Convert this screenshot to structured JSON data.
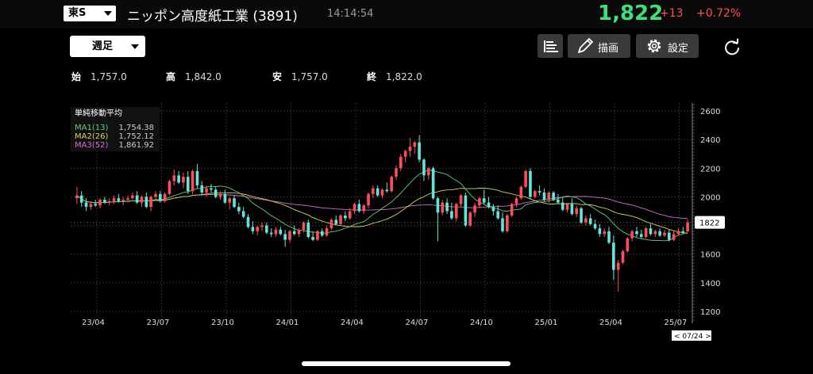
{
  "header": {
    "market": "東S",
    "title": "ニッポン高度紙工業 (3891)",
    "time": "14:14:54",
    "price": "1,822",
    "change": "+13",
    "change_percent": "+0.72%"
  },
  "toolbar": {
    "period": "週足",
    "draw_label": "描画",
    "settings_label": "設定"
  },
  "ohlc": [
    {
      "label": "始",
      "value": "1,757.0"
    },
    {
      "label": "高",
      "value": "1,842.0"
    },
    {
      "label": "安",
      "value": "1,757.0"
    },
    {
      "label": "終",
      "value": "1,822.0"
    }
  ],
  "ma_legend": {
    "title": "単純移動平均",
    "items": [
      {
        "name": "MA1(13)",
        "value": "1,754.38",
        "color": "#5fd07a"
      },
      {
        "name": "MA2(26)",
        "value": "1,752.12",
        "color": "#d4d45a"
      },
      {
        "name": "MA3(52)",
        "value": "1,861.92",
        "color": "#d66bd0"
      }
    ]
  },
  "colors": {
    "up": "#ff4d5a",
    "down": "#63e6d9",
    "price_green": "#3ee07a"
  },
  "chart_data": {
    "type": "candlestick",
    "ylim": [
      1200,
      2600
    ],
    "y_ticks": [
      "2600",
      "2400",
      "2200",
      "2000",
      "1800",
      "1600",
      "1400",
      "1200"
    ],
    "x_ticks": [
      "23/04",
      "23/07",
      "23/10",
      "24/01",
      "24/04",
      "24/07",
      "24/10",
      "25/01",
      "25/04",
      "25/07"
    ],
    "last_price_label": "1822",
    "cursor_label": "< 07/24 >",
    "candles": [
      [
        1990,
        2070,
        1950,
        2010
      ],
      [
        2010,
        2040,
        1930,
        1960
      ],
      [
        1960,
        1990,
        1900,
        1930
      ],
      [
        1930,
        1970,
        1910,
        1950
      ],
      [
        1950,
        1980,
        1930,
        1940
      ],
      [
        1940,
        1990,
        1920,
        1980
      ],
      [
        1980,
        2000,
        1950,
        1960
      ],
      [
        1960,
        1990,
        1940,
        1970
      ],
      [
        1970,
        2010,
        1950,
        1990
      ],
      [
        1990,
        2020,
        1960,
        1970
      ],
      [
        1970,
        2000,
        1940,
        1980
      ],
      [
        1980,
        2010,
        1960,
        1990
      ],
      [
        1990,
        2030,
        1980,
        2010
      ],
      [
        2010,
        2040,
        1950,
        1960
      ],
      [
        1960,
        2010,
        1930,
        2000
      ],
      [
        2000,
        2030,
        1920,
        1930
      ],
      [
        1930,
        2010,
        1900,
        2000
      ],
      [
        2000,
        2040,
        1980,
        2020
      ],
      [
        2020,
        2040,
        1960,
        1970
      ],
      [
        1970,
        2030,
        1960,
        2020
      ],
      [
        2020,
        2120,
        2010,
        2110
      ],
      [
        2110,
        2190,
        2080,
        2150
      ],
      [
        2150,
        2180,
        2090,
        2100
      ],
      [
        2100,
        2170,
        2060,
        2140
      ],
      [
        2140,
        2180,
        2020,
        2040
      ],
      [
        2040,
        2190,
        2020,
        2180
      ],
      [
        2180,
        2230,
        2060,
        2080
      ],
      [
        2080,
        2110,
        2010,
        2030
      ],
      [
        2030,
        2080,
        2000,
        2060
      ],
      [
        2060,
        2090,
        2030,
        2050
      ],
      [
        2050,
        2070,
        1990,
        2000
      ],
      [
        2000,
        2040,
        1980,
        2020
      ],
      [
        2020,
        2050,
        1950,
        1960
      ],
      [
        1960,
        2000,
        1910,
        1990
      ],
      [
        1990,
        2010,
        1920,
        1930
      ],
      [
        1930,
        1960,
        1880,
        1900
      ],
      [
        1900,
        1930,
        1850,
        1860
      ],
      [
        1860,
        1880,
        1780,
        1790
      ],
      [
        1790,
        1830,
        1740,
        1760
      ],
      [
        1760,
        1800,
        1730,
        1790
      ],
      [
        1790,
        1820,
        1760,
        1800
      ],
      [
        1800,
        1820,
        1740,
        1750
      ],
      [
        1750,
        1780,
        1720,
        1740
      ],
      [
        1740,
        1790,
        1720,
        1770
      ],
      [
        1770,
        1790,
        1730,
        1740
      ],
      [
        1740,
        1770,
        1650,
        1700
      ],
      [
        1700,
        1770,
        1680,
        1760
      ],
      [
        1760,
        1800,
        1730,
        1740
      ],
      [
        1740,
        1780,
        1720,
        1770
      ],
      [
        1770,
        1830,
        1750,
        1820
      ],
      [
        1820,
        1840,
        1710,
        1720
      ],
      [
        1720,
        1760,
        1690,
        1700
      ],
      [
        1700,
        1770,
        1690,
        1760
      ],
      [
        1760,
        1780,
        1720,
        1730
      ],
      [
        1730,
        1800,
        1720,
        1780
      ],
      [
        1780,
        1850,
        1770,
        1840
      ],
      [
        1840,
        1870,
        1800,
        1810
      ],
      [
        1810,
        1880,
        1800,
        1870
      ],
      [
        1870,
        1900,
        1830,
        1850
      ],
      [
        1850,
        1920,
        1840,
        1900
      ],
      [
        1900,
        1960,
        1880,
        1950
      ],
      [
        1950,
        1980,
        1890,
        1900
      ],
      [
        1900,
        1950,
        1880,
        1940
      ],
      [
        1940,
        2030,
        1920,
        2020
      ],
      [
        2020,
        2080,
        1990,
        2060
      ],
      [
        2060,
        2080,
        2000,
        2010
      ],
      [
        2010,
        2060,
        1990,
        2050
      ],
      [
        2050,
        2100,
        2030,
        2040
      ],
      [
        2040,
        2150,
        2030,
        2140
      ],
      [
        2140,
        2220,
        2120,
        2200
      ],
      [
        2200,
        2300,
        2180,
        2280
      ],
      [
        2280,
        2330,
        2240,
        2320
      ],
      [
        2320,
        2410,
        2280,
        2350
      ],
      [
        2350,
        2390,
        2300,
        2380
      ],
      [
        2380,
        2430,
        2240,
        2260
      ],
      [
        2260,
        2270,
        2110,
        2150
      ],
      [
        2150,
        2210,
        2120,
        2200
      ],
      [
        2200,
        2210,
        1980,
        1990
      ],
      [
        1990,
        2000,
        1690,
        1890
      ],
      [
        1890,
        1980,
        1870,
        1960
      ],
      [
        1960,
        1990,
        1880,
        1900
      ],
      [
        1900,
        1960,
        1840,
        1850
      ],
      [
        1850,
        1960,
        1830,
        1950
      ],
      [
        1950,
        2020,
        1930,
        2010
      ],
      [
        2010,
        2030,
        1790,
        1800
      ],
      [
        1800,
        1900,
        1790,
        1890
      ],
      [
        1890,
        1960,
        1860,
        1940
      ],
      [
        1940,
        2000,
        1920,
        1990
      ],
      [
        1990,
        2050,
        1950,
        1960
      ],
      [
        1960,
        2000,
        1920,
        1930
      ],
      [
        1930,
        1950,
        1870,
        1900
      ],
      [
        1900,
        1940,
        1840,
        1850
      ],
      [
        1850,
        1890,
        1750,
        1760
      ],
      [
        1760,
        1880,
        1750,
        1870
      ],
      [
        1870,
        1960,
        1860,
        1950
      ],
      [
        1950,
        2000,
        1930,
        1990
      ],
      [
        1990,
        2080,
        1980,
        2070
      ],
      [
        2070,
        2190,
        2060,
        2180
      ],
      [
        2180,
        2200,
        1980,
        2000
      ],
      [
        2000,
        2050,
        1990,
        2040
      ],
      [
        2040,
        2080,
        2010,
        2030
      ],
      [
        2030,
        2060,
        1970,
        1980
      ],
      [
        1980,
        2040,
        1960,
        2030
      ],
      [
        2030,
        2040,
        1970,
        1980
      ],
      [
        1980,
        2020,
        1950,
        1960
      ],
      [
        1960,
        2000,
        1900,
        1910
      ],
      [
        1910,
        1960,
        1890,
        1950
      ],
      [
        1950,
        1990,
        1870,
        1880
      ],
      [
        1880,
        1940,
        1860,
        1920
      ],
      [
        1920,
        1930,
        1810,
        1820
      ],
      [
        1820,
        1870,
        1800,
        1850
      ],
      [
        1850,
        1880,
        1800,
        1810
      ],
      [
        1810,
        1840,
        1770,
        1780
      ],
      [
        1780,
        1810,
        1720,
        1740
      ],
      [
        1740,
        1780,
        1720,
        1760
      ],
      [
        1760,
        1790,
        1670,
        1680
      ],
      [
        1680,
        1730,
        1420,
        1490
      ],
      [
        1490,
        1560,
        1340,
        1540
      ],
      [
        1540,
        1630,
        1530,
        1620
      ],
      [
        1620,
        1720,
        1610,
        1710
      ],
      [
        1710,
        1770,
        1690,
        1760
      ],
      [
        1760,
        1790,
        1720,
        1740
      ],
      [
        1740,
        1770,
        1710,
        1720
      ],
      [
        1720,
        1790,
        1710,
        1780
      ],
      [
        1780,
        1810,
        1730,
        1740
      ],
      [
        1740,
        1770,
        1720,
        1760
      ],
      [
        1760,
        1780,
        1720,
        1730
      ],
      [
        1730,
        1770,
        1720,
        1750
      ],
      [
        1750,
        1770,
        1690,
        1700
      ],
      [
        1700,
        1760,
        1690,
        1740
      ],
      [
        1740,
        1780,
        1730,
        1760
      ],
      [
        1760,
        1790,
        1740,
        1750
      ],
      [
        1757,
        1842,
        1757,
        1822
      ]
    ]
  }
}
